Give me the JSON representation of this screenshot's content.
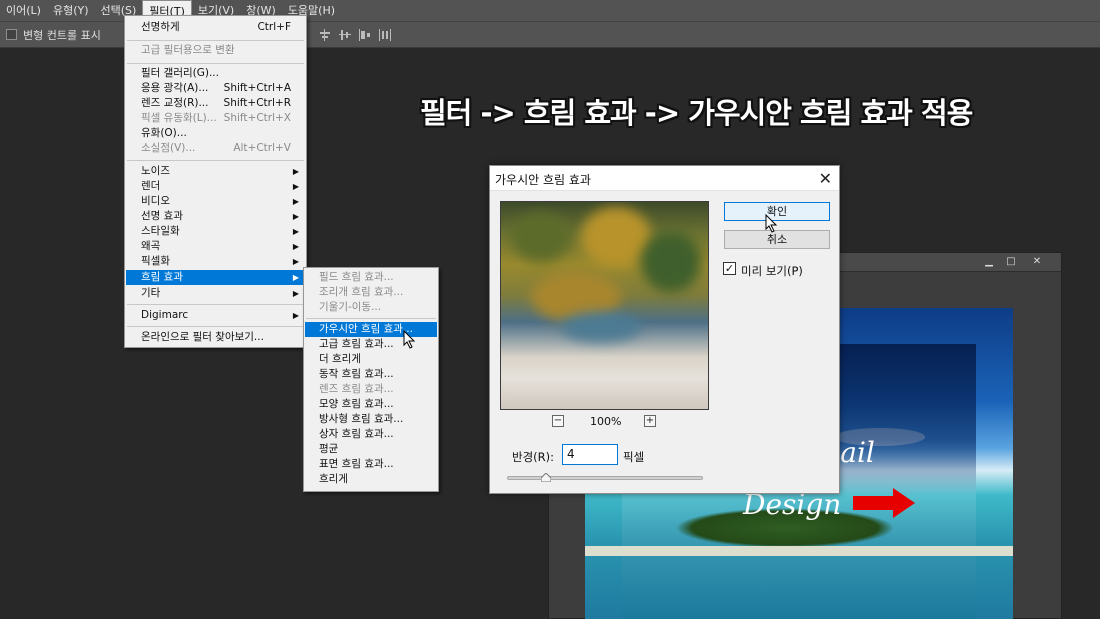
{
  "menubar": {
    "items": [
      "이어(L)",
      "유형(Y)",
      "선택(S)",
      "필터(T)",
      "보기(V)",
      "창(W)",
      "도움말(H)"
    ],
    "active_index": 3
  },
  "options_bar": {
    "show_transform_controls_label": "변형 컨트롤 표시",
    "show_transform_controls_checked": false
  },
  "overlay": {
    "title": "필터 -> 흐림 효과 -> 가우시안 흐림 효과 적용"
  },
  "filter_menu": {
    "items": [
      {
        "label": "선명하게",
        "shortcut": "Ctrl+F",
        "disabled": false
      },
      {
        "label": "고급 필터용으로 변환",
        "disabled": true
      },
      {
        "label": "필터 갤러리(G)...",
        "disabled": false
      },
      {
        "label": "응용 광각(A)...",
        "shortcut": "Shift+Ctrl+A",
        "disabled": false
      },
      {
        "label": "렌즈 교정(R)...",
        "shortcut": "Shift+Ctrl+R",
        "disabled": false
      },
      {
        "label": "픽셀 유동화(L)...",
        "shortcut": "Shift+Ctrl+X",
        "disabled": true
      },
      {
        "label": "유화(O)...",
        "disabled": false
      },
      {
        "label": "소실점(V)...",
        "shortcut": "Alt+Ctrl+V",
        "disabled": true
      },
      {
        "label": "노이즈",
        "submenu": true
      },
      {
        "label": "렌더",
        "submenu": true
      },
      {
        "label": "비디오",
        "submenu": true
      },
      {
        "label": "선명 효과",
        "submenu": true
      },
      {
        "label": "스타일화",
        "submenu": true
      },
      {
        "label": "왜곡",
        "submenu": true
      },
      {
        "label": "픽셀화",
        "submenu": true
      },
      {
        "label": "흐림 효과",
        "submenu": true,
        "selected": true
      },
      {
        "label": "기타",
        "submenu": true
      },
      {
        "label": "Digimarc",
        "submenu": true
      },
      {
        "label": "온라인으로 필터 찾아보기..."
      }
    ]
  },
  "blur_submenu": {
    "items": [
      {
        "label": "필드 흐림 효과...",
        "disabled": true
      },
      {
        "label": "조리개 흐림 효과...",
        "disabled": true
      },
      {
        "label": "기울기-이동...",
        "disabled": true
      },
      {
        "label": "가우시안 흐림 효과...",
        "selected": true
      },
      {
        "label": "고급 흐림 효과..."
      },
      {
        "label": "더 흐리게"
      },
      {
        "label": "동작 흐림 효과..."
      },
      {
        "label": "렌즈 흐림 효과...",
        "disabled": true
      },
      {
        "label": "모양 흐림 효과..."
      },
      {
        "label": "방사형 흐림 효과..."
      },
      {
        "label": "상자 흐림 효과..."
      },
      {
        "label": "평균"
      },
      {
        "label": "표면 흐림 효과..."
      },
      {
        "label": "흐리게"
      }
    ]
  },
  "dialog": {
    "title": "가우시안 흐림 효과",
    "ok_label": "확인",
    "cancel_label": "취소",
    "preview_label": "미리 보기(P)",
    "preview_checked": true,
    "zoom": "100%",
    "radius_label": "반경(R):",
    "radius_value": "4",
    "radius_unit": "픽셀",
    "slider_fraction": 0.2
  },
  "document": {
    "script_line1": "Thumbnail",
    "script_line2": "Design"
  },
  "colors": {
    "menu_highlight": "#0078d7",
    "ps_panel": "#535353",
    "ps_background": "#282828"
  }
}
